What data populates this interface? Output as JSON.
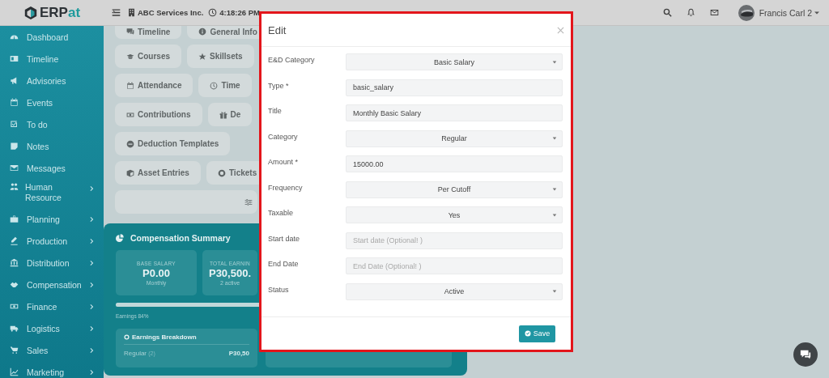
{
  "app": {
    "logo": "ERPat"
  },
  "topbar": {
    "company": "ABC Services Inc.",
    "time": "4:18:26 PM",
    "user": "Francis Carl 2"
  },
  "sidebar": {
    "items": [
      {
        "label": "Dashboard",
        "expandable": false
      },
      {
        "label": "Timeline",
        "expandable": false
      },
      {
        "label": "Advisories",
        "expandable": false
      },
      {
        "label": "Events",
        "expandable": false
      },
      {
        "label": "To do",
        "expandable": false
      },
      {
        "label": "Notes",
        "expandable": false
      },
      {
        "label": "Messages",
        "expandable": false
      },
      {
        "label": "Human Resource",
        "expandable": true
      },
      {
        "label": "Planning",
        "expandable": true
      },
      {
        "label": "Production",
        "expandable": true
      },
      {
        "label": "Distribution",
        "expandable": true
      },
      {
        "label": "Compensation",
        "expandable": true
      },
      {
        "label": "Finance",
        "expandable": true
      },
      {
        "label": "Logistics",
        "expandable": true
      },
      {
        "label": "Sales",
        "expandable": true
      },
      {
        "label": "Marketing",
        "expandable": true
      }
    ]
  },
  "module_buttons": [
    [
      {
        "label": "Timeline"
      },
      {
        "label": "General Info"
      }
    ],
    [
      {
        "label": "Courses"
      },
      {
        "label": "Skillsets"
      }
    ],
    [
      {
        "label": "Attendance"
      },
      {
        "label": "Time"
      }
    ],
    [
      {
        "label": "Contributions"
      },
      {
        "label": "De"
      }
    ],
    [
      {
        "label": "Deduction Templates"
      }
    ],
    [
      {
        "label": "Asset Entries"
      },
      {
        "label": "Tickets"
      }
    ]
  ],
  "compensation_summary": {
    "title": "Compensation Summary",
    "stats": [
      {
        "label": "BASE SALARY",
        "value": "P0.00",
        "note": "Monthly"
      },
      {
        "label": "TOTAL EARNIN",
        "value": "P30,500.",
        "note": "2 active"
      }
    ],
    "progress": {
      "level": 0.84,
      "label": "Earnings 84%"
    },
    "breakdown": {
      "title": "Earnings Breakdown",
      "rows": [
        {
          "name": "Regular",
          "count": "(2)",
          "amount": "P30,50"
        }
      ]
    }
  },
  "modal": {
    "title": "Edit",
    "fields": [
      {
        "label": "E&D Category",
        "kind": "select",
        "value": "Basic Salary"
      },
      {
        "label": "Type *",
        "kind": "input",
        "value": "basic_salary"
      },
      {
        "label": "Title",
        "kind": "input",
        "value": "Monthly Basic Salary"
      },
      {
        "label": "Category",
        "kind": "select",
        "value": "Regular"
      },
      {
        "label": "Amount *",
        "kind": "input",
        "value": "15000.00"
      },
      {
        "label": "Frequency",
        "kind": "select",
        "value": "Per Cutoff"
      },
      {
        "label": "Taxable",
        "kind": "select",
        "value": "Yes"
      },
      {
        "label": "Start date",
        "kind": "input",
        "placeholder": "Start date (Optional! )"
      },
      {
        "label": "End Date",
        "kind": "input",
        "placeholder": "End Date (Optional! )"
      },
      {
        "label": "Status",
        "kind": "select",
        "value": "Active"
      }
    ],
    "save_button": "Save"
  }
}
